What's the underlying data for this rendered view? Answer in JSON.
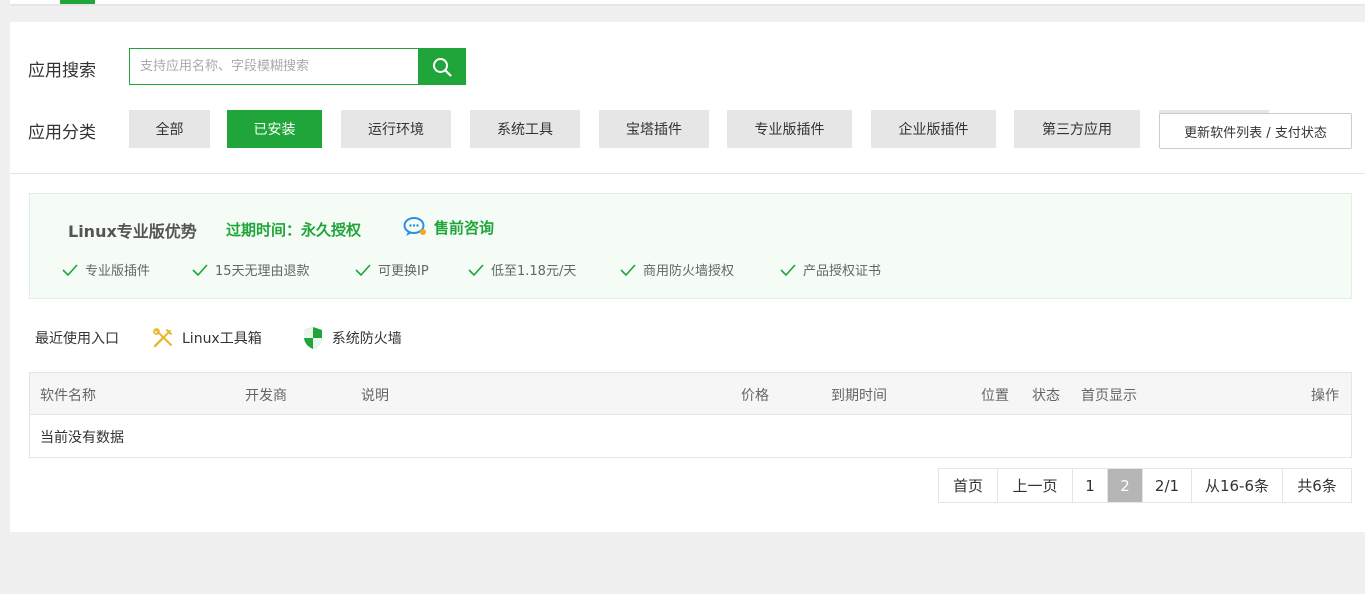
{
  "search": {
    "label": "应用搜索",
    "placeholder": "支持应用名称、字段模糊搜索",
    "value": ""
  },
  "categories": {
    "label": "应用分类",
    "items": [
      {
        "label": "全部",
        "active": false
      },
      {
        "label": "已安装",
        "active": true
      },
      {
        "label": "运行环境",
        "active": false
      },
      {
        "label": "系统工具",
        "active": false
      },
      {
        "label": "宝塔插件",
        "active": false
      },
      {
        "label": "专业版插件",
        "active": false
      },
      {
        "label": "企业版插件",
        "active": false
      },
      {
        "label": "第三方应用",
        "active": false
      }
    ],
    "update_button": "更新软件列表 / 支付状态"
  },
  "pro": {
    "title": "Linux专业版优势",
    "expire": "过期时间：永久授权",
    "consult": "售前咨询",
    "features": [
      "专业版插件",
      "15天无理由退款",
      "可更换IP",
      "低至1.18元/天",
      "商用防火墙授权",
      "产品授权证书"
    ]
  },
  "recent": {
    "label": "最近使用入口",
    "items": [
      {
        "label": "Linux工具箱",
        "icon": "tools-icon"
      },
      {
        "label": "系统防火墙",
        "icon": "shield-icon"
      }
    ]
  },
  "table": {
    "columns": [
      "软件名称",
      "开发商",
      "说明",
      "价格",
      "到期时间",
      "位置",
      "状态",
      "首页显示",
      "操作"
    ],
    "empty_text": "当前没有数据"
  },
  "pagination": {
    "first": "首页",
    "prev": "上一页",
    "page1": "1",
    "page2": "2",
    "pages": "2/1",
    "range": "从16-6条",
    "total": "共6条",
    "current": 2
  },
  "colors": {
    "accent": "#20a53a",
    "page_bg": "#f0f0f0",
    "pager_current": "#b5b5b5"
  }
}
